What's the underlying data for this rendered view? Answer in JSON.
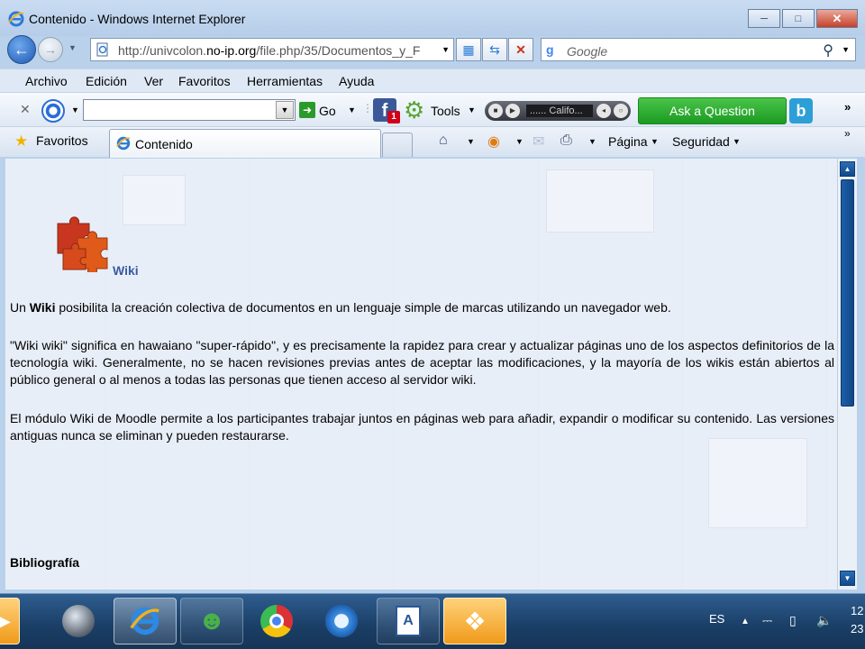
{
  "window": {
    "title": "Contenido - Windows Internet Explorer",
    "minimize_icon": "minimize-icon",
    "maximize_icon": "maximize-icon",
    "close_icon": "close-icon"
  },
  "address_bar": {
    "url_prefix": "http://univcolon.",
    "url_domain": "no-ip.org",
    "url_suffix": "/file.php/35/Documentos_y_F",
    "search_placeholder": "Google"
  },
  "menu": {
    "items": [
      "Archivo",
      "Edición",
      "Ver",
      "Favoritos",
      "Herramientas",
      "Ayuda"
    ]
  },
  "toolbar": {
    "go_label": "Go",
    "tools_label": "Tools",
    "facebook_badge": "1",
    "media_text": "...... Califo...",
    "ask_button": "Ask a Question",
    "more": "»"
  },
  "favorites_bar": {
    "favorites_label": "Favoritos",
    "tab_label": "Contenido",
    "page_menu": "Página",
    "safety_menu": "Seguridad",
    "more": "»"
  },
  "content": {
    "image_caption": "Wiki",
    "p1_before": "Un ",
    "p1_bold": "Wiki",
    "p1_after": " posibilita la creación colectiva de documentos en un lenguaje simple de marcas utilizando un navegador web.",
    "p2": "\"Wiki wiki\" significa en hawaiano \"super-rápido\", y es precisamente la rapidez para crear y actualizar páginas uno de los aspectos definitorios de la tecnología wiki. Generalmente, no se hacen revisiones previas antes de aceptar las modificaciones, y la mayoría de los wikis están abiertos al público general o al menos a todas las personas que tienen acceso al servidor wiki.",
    "p3": "El módulo Wiki de Moodle permite a los participantes trabajar juntos en páginas web para añadir, expandir o modificar su contenido. Las versiones antiguas nunca se eliminan y pueden restaurarse.",
    "bibliography_heading": "Bibliografía"
  },
  "taskbar": {
    "language": "ES",
    "clock_line1": "12",
    "clock_line2": "23"
  },
  "colors": {
    "ask_button": "#1b9a22",
    "scrollbar": "#114a8c",
    "taskbar": "#1a3e66"
  }
}
